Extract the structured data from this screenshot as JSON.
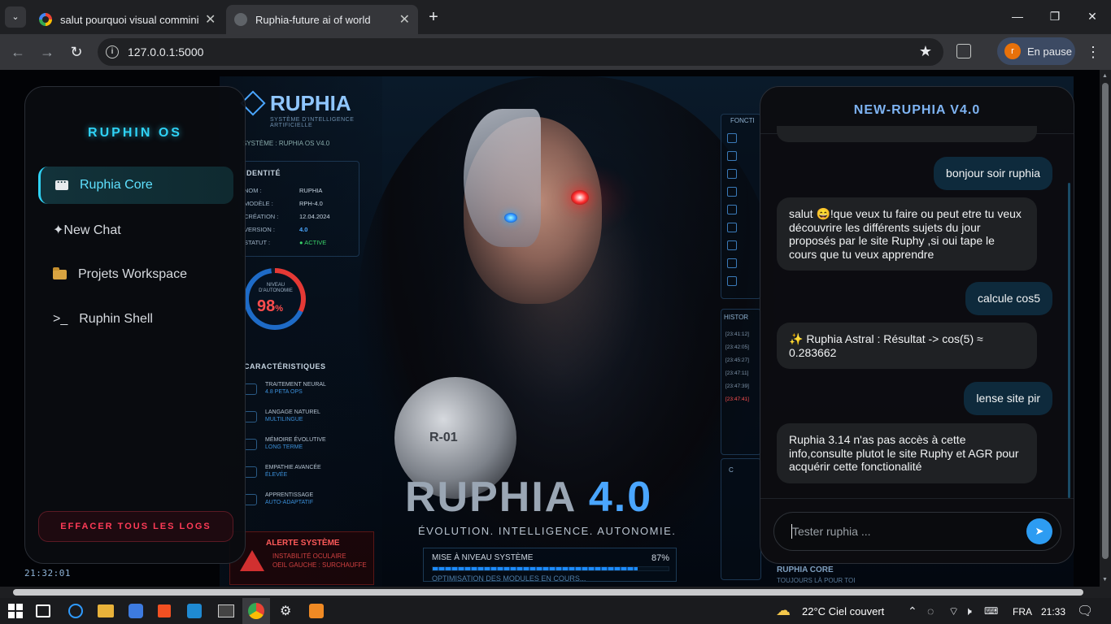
{
  "browser": {
    "tabs": [
      {
        "title": "salut pourquoi visual comminity",
        "active": false
      },
      {
        "title": "Ruphia-future ai of world",
        "active": true
      }
    ],
    "url": "127.0.0.1:5000",
    "profile_label": "En pause",
    "profile_initial": "r"
  },
  "poster": {
    "logo": "RUPHIA",
    "logo_sub": "SYSTÈME D'INTELLIGENCE ARTIFICIELLE",
    "system_line": "SYSTÈME : RUPHIA OS V4.0",
    "identity_title": "IDENTITÉ",
    "identity_rows": [
      {
        "k": "NOM :",
        "v": "RUPHIA"
      },
      {
        "k": "MODÈLE :",
        "v": "RPH-4.0"
      },
      {
        "k": "CRÉATION :",
        "v": "12.04.2024"
      },
      {
        "k": "VERSION :",
        "v": "4.0"
      },
      {
        "k": "STATUT :",
        "v": "● ACTIVE"
      }
    ],
    "autonomy_label": "NIVEAU D'AUTONOMIE",
    "autonomy_value": "98",
    "autonomy_unit": "%",
    "features_title": "CARACTÉRISTIQUES",
    "features": [
      {
        "name": "TRAITEMENT NEURAL",
        "sub": "4.8 PETA OPS"
      },
      {
        "name": "LANGAGE NATUREL",
        "sub": "MULTILINGUE"
      },
      {
        "name": "MÉMOIRE ÉVOLUTIVE",
        "sub": "LONG TERME"
      },
      {
        "name": "EMPATHIE AVANCÉE",
        "sub": "ÉLEVÉE"
      },
      {
        "name": "APPRENTISSAGE",
        "sub": "AUTO-ADAPTATIF"
      }
    ],
    "alert_title": "ALERTE SYSTÈME",
    "alert_line1": "INSTABILITÉ OCULAIRE",
    "alert_line2": "OEIL GAUCHE : SURCHAUFFE",
    "shoulder_mark": "R-01",
    "title_main": "RUPHIA",
    "title_version": "4.0",
    "slogan": "ÉVOLUTION. INTELLIGENCE. AUTONOMIE.",
    "upgrade_label": "MISE À NIVEAU SYSTÈME",
    "upgrade_pct": "87%",
    "upgrade_fraction": 0.87,
    "upgrade_sub": "OPTIMISATION DES MODULES EN COURS...",
    "right_functions": "FONCTI",
    "history_title": "HISTOR",
    "history_times": [
      "[23:41:12]",
      "[23:42:05]",
      "[23:45:27]",
      "[23:47:11]",
      "[23:47:39]",
      "[23:47:41]"
    ],
    "right_c": "C",
    "core_title": "RUPHIA CORE",
    "core_sub": "TOUJOURS LÀ POUR TOI"
  },
  "sidebar": {
    "brand": "RUPHIN OS",
    "items": [
      {
        "label": "Ruphia Core",
        "icon": "chat-bubble-icon",
        "active": true
      },
      {
        "label": "✦New Chat",
        "icon": "",
        "active": false
      },
      {
        "label": "Projets Workspace",
        "icon": "folder-icon",
        "active": false
      },
      {
        "label": "Ruphin Shell",
        "icon": "terminal-icon",
        "prefix": ">_",
        "active": false
      }
    ],
    "clear_logs": "EFFACER TOUS LES LOGS"
  },
  "clock": "21:32:01",
  "chat": {
    "title": "NEW-RUPHIA V4.0",
    "messages": [
      {
        "role": "user",
        "text": "bonjour soir ruphia"
      },
      {
        "role": "bot",
        "text": "salut 😄!que veux tu faire ou peut etre tu veux découvrire les différents sujets du jour proposés par le site Ruphy ,si oui tape le cours que tu veux apprendre"
      },
      {
        "role": "user",
        "text": "calcule cos5"
      },
      {
        "role": "bot",
        "text": "✨ Ruphia Astral : Résultat -> cos(5) ≈ 0.283662"
      },
      {
        "role": "user",
        "text": "lense site pir"
      },
      {
        "role": "bot",
        "text": "Ruphia 3.14 n'as pas accès à cette info,consulte plutot le site Ruphy et AGR pour acquérir cette fonctionalité"
      }
    ],
    "input_placeholder": "Tester ruphia ..."
  },
  "taskbar": {
    "weather": "22°C  Ciel couvert",
    "lang": "FRA",
    "time": "21:33"
  },
  "colors": {
    "accent_cyan": "#2fd2f5",
    "chat_title": "#7eb3f2",
    "danger": "#ff3b57",
    "send_button": "#2d9cf2"
  }
}
